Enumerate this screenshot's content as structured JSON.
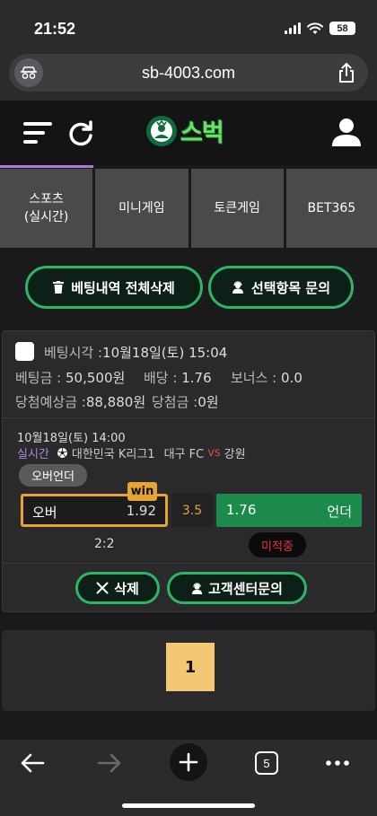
{
  "status_bar": {
    "time": "21:52",
    "battery": "58"
  },
  "browser": {
    "url": "sb-4003.com"
  },
  "site": {
    "logo_text": "스벅"
  },
  "nav_tabs": [
    {
      "line1": "스포츠",
      "line2": "(실시간)"
    },
    {
      "line1": "미니게임",
      "line2": ""
    },
    {
      "line1": "토큰게임",
      "line2": ""
    },
    {
      "line1": "BET365",
      "line2": ""
    }
  ],
  "actions": {
    "delete_all": "베팅내역 전체삭제",
    "inquire_selected": "선택항목 문의"
  },
  "bet": {
    "bet_time_label": "베팅시각 :",
    "bet_time_value": "10월18일(토) 15:04",
    "amount_label": "베팅금 :",
    "amount_value": "50,500원",
    "odds_label": "배당 :",
    "odds_value": "1.76",
    "bonus_label": "보너스 :",
    "bonus_value": "0.0",
    "expected_label": "당첨예상금 :",
    "expected_value": "88,880원",
    "win_label": "당첨금 :",
    "win_value": "0원",
    "match": {
      "date": "10월18일(토) 14:00",
      "live": "실시간",
      "league": "대한민국 K리그1",
      "home": "대구 FC",
      "vs": "vs",
      "away": "강원",
      "market": "오버언더",
      "over_label": "오버",
      "over_odds": "1.92",
      "win_badge": "win",
      "handicap": "3.5",
      "under_odds": "1.76",
      "under_label": "언더",
      "score": "2:2",
      "status": "미적중"
    },
    "delete_button": "삭제",
    "support_button": "고객센터문의"
  },
  "pagination": {
    "current": "1"
  },
  "toolbar": {
    "tab_count": "5"
  },
  "colors": {
    "accent_green": "#2db566",
    "win_orange": "#e6a431",
    "lose_red": "#e5343a"
  }
}
